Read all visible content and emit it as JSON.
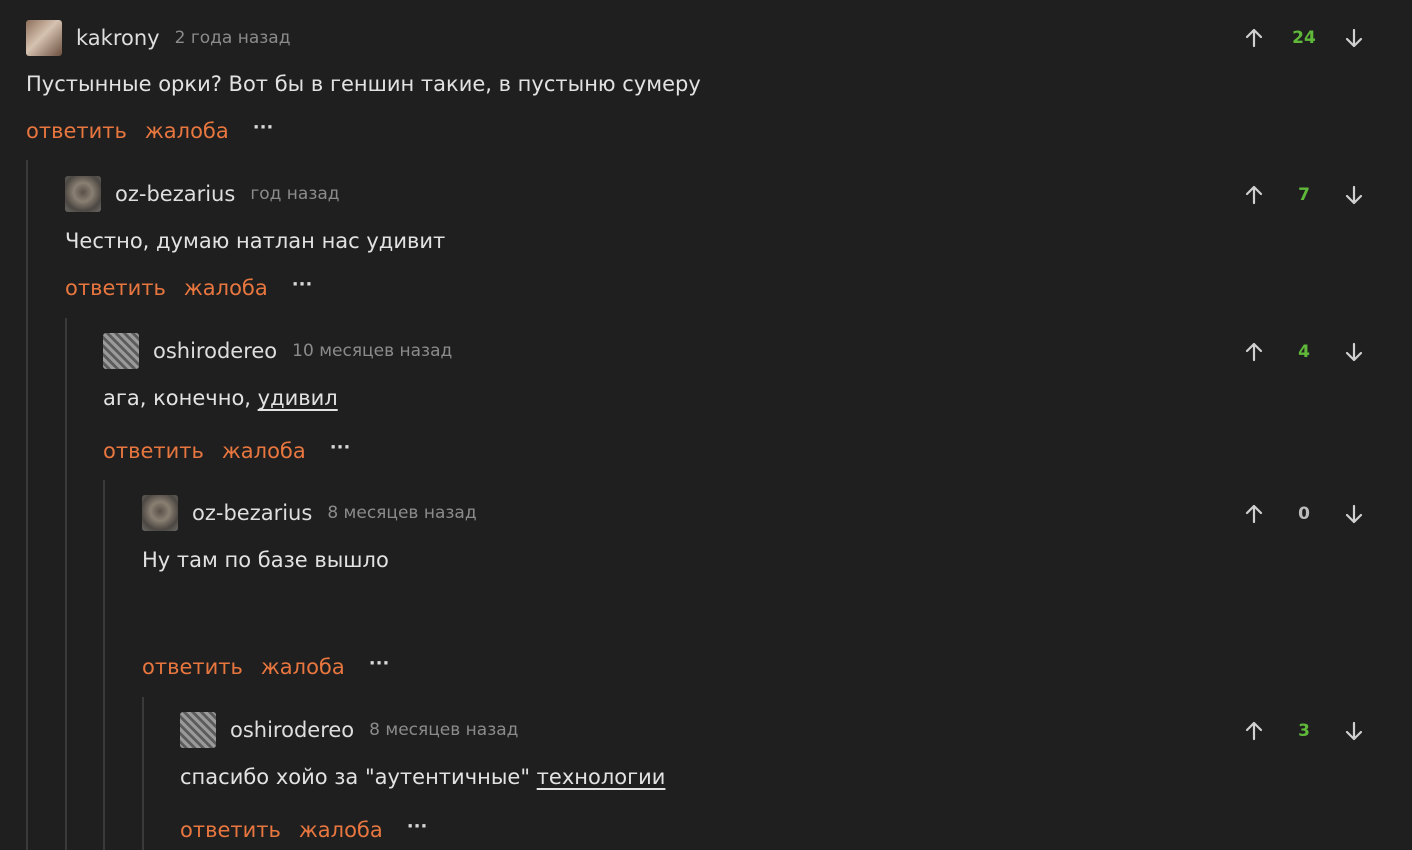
{
  "comments": [
    {
      "username": "kakrony",
      "ago": "2 года назад",
      "score": "24",
      "text": "Пустынные орки? Вот бы в геншин такие, в пустыню сумеру",
      "reply": "ответить",
      "report": "жалоба",
      "more": "···"
    },
    {
      "username": "oz-bezarius",
      "ago": "год назад",
      "score": "7",
      "text": "Честно, думаю натлан нас удивит",
      "reply": "ответить",
      "report": "жалоба",
      "more": "···"
    },
    {
      "username": "oshirodereo",
      "ago": "10 месяцев назад",
      "score": "4",
      "text_pre": "ага, конечно, ",
      "text_link": "удивил",
      "reply": "ответить",
      "report": "жалоба",
      "more": "···"
    },
    {
      "username": "oz-bezarius",
      "ago": "8 месяцев назад",
      "score": "0",
      "text": "Ну там по базе вышло",
      "reply": "ответить",
      "report": "жалоба",
      "more": "···"
    },
    {
      "username": "oshirodereo",
      "ago": "8 месяцев назад",
      "score": "3",
      "text_pre": "спасибо хойо за \"аутентичные\" ",
      "text_link": "технологии",
      "reply": "ответить",
      "report": "жалоба",
      "more": "···"
    }
  ],
  "icons": {
    "upvote": "arrow-up-icon",
    "downvote": "arrow-down-icon"
  },
  "colors": {
    "background": "#1f1f1f",
    "action": "#e8763f",
    "score_positive": "#5fb83a"
  }
}
